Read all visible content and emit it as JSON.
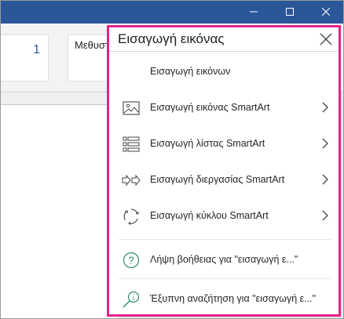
{
  "ribbon": {
    "style_left_fragment": "1",
    "style_name": "Μεθυστικός Α"
  },
  "insert_panel": {
    "title": "Εισαγωγή εικόνας",
    "items": [
      {
        "label": "Εισαγωγή εικόνων",
        "icon": "none",
        "has_submenu": false
      },
      {
        "label": "Εισαγωγή εικόνας SmartArt",
        "icon": "picture-icon",
        "has_submenu": true
      },
      {
        "label": "Εισαγωγή λίστας SmartArt",
        "icon": "list-icon",
        "has_submenu": true
      },
      {
        "label": "Εισαγωγή διεργασίας SmartArt",
        "icon": "process-arrows-icon",
        "has_submenu": true
      },
      {
        "label": "Εισαγωγή κύκλου SmartArt",
        "icon": "cycle-icon",
        "has_submenu": true
      },
      {
        "label": "Λήψη βοήθειας για \"εισαγωγή ε...\"",
        "icon": "help-icon",
        "has_submenu": false
      },
      {
        "label": "Έξυπνη αναζήτηση για \"εισαγωγή ε...\"",
        "icon": "smart-lookup-icon",
        "has_submenu": false
      }
    ]
  },
  "colors": {
    "title_bar": "#2b579a",
    "highlight_border": "#e3238a"
  }
}
